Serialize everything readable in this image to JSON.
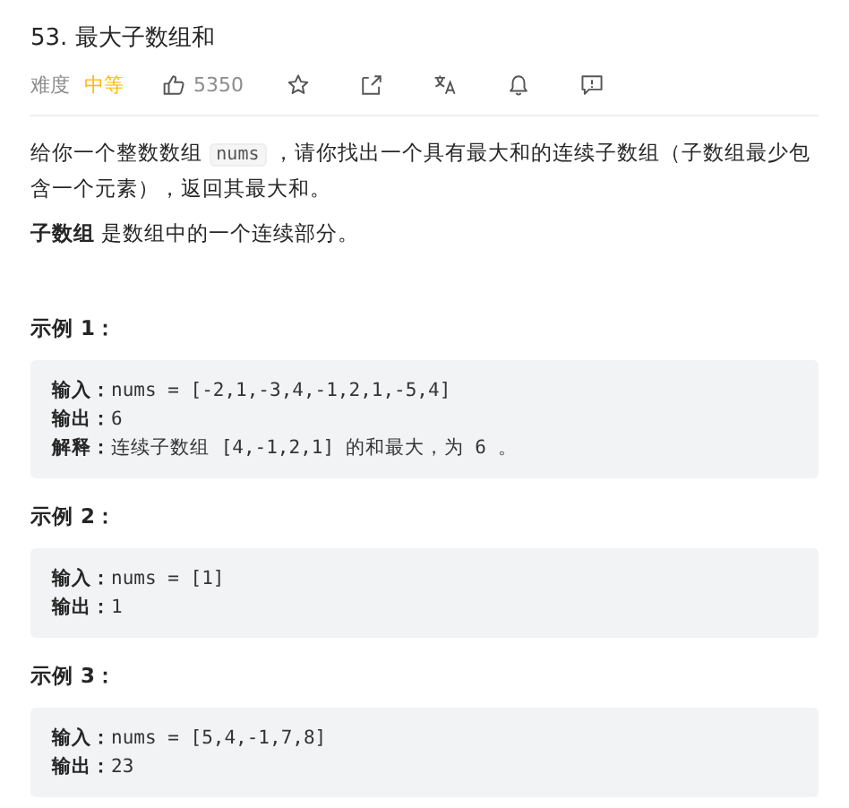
{
  "title": "53. 最大子数组和",
  "meta": {
    "difficulty_label": "难度",
    "difficulty": "中等",
    "likes": "5350"
  },
  "description": {
    "before": "给你一个整数数组 ",
    "code": "nums",
    "after": " ，请你找出一个具有最大和的连续子数组（子数组最少包含一个元素），返回其最大和。"
  },
  "note": "**子数组** 是数组中的一个连续部分。",
  "examples": [
    {
      "heading": "示例 1：",
      "lines": [
        "**输入：**nums = [-2,1,-3,4,-1,2,1,-5,4]",
        "**输出：**6",
        "**解释：**连续子数组 [4,-1,2,1] 的和最大，为 6 。"
      ]
    },
    {
      "heading": "示例 2：",
      "lines": [
        "**输入：**nums = [1]",
        "**输出：**1"
      ]
    },
    {
      "heading": "示例 3：",
      "lines": [
        "**输入：**nums = [5,4,-1,7,8]",
        "**输出：**23"
      ]
    }
  ]
}
